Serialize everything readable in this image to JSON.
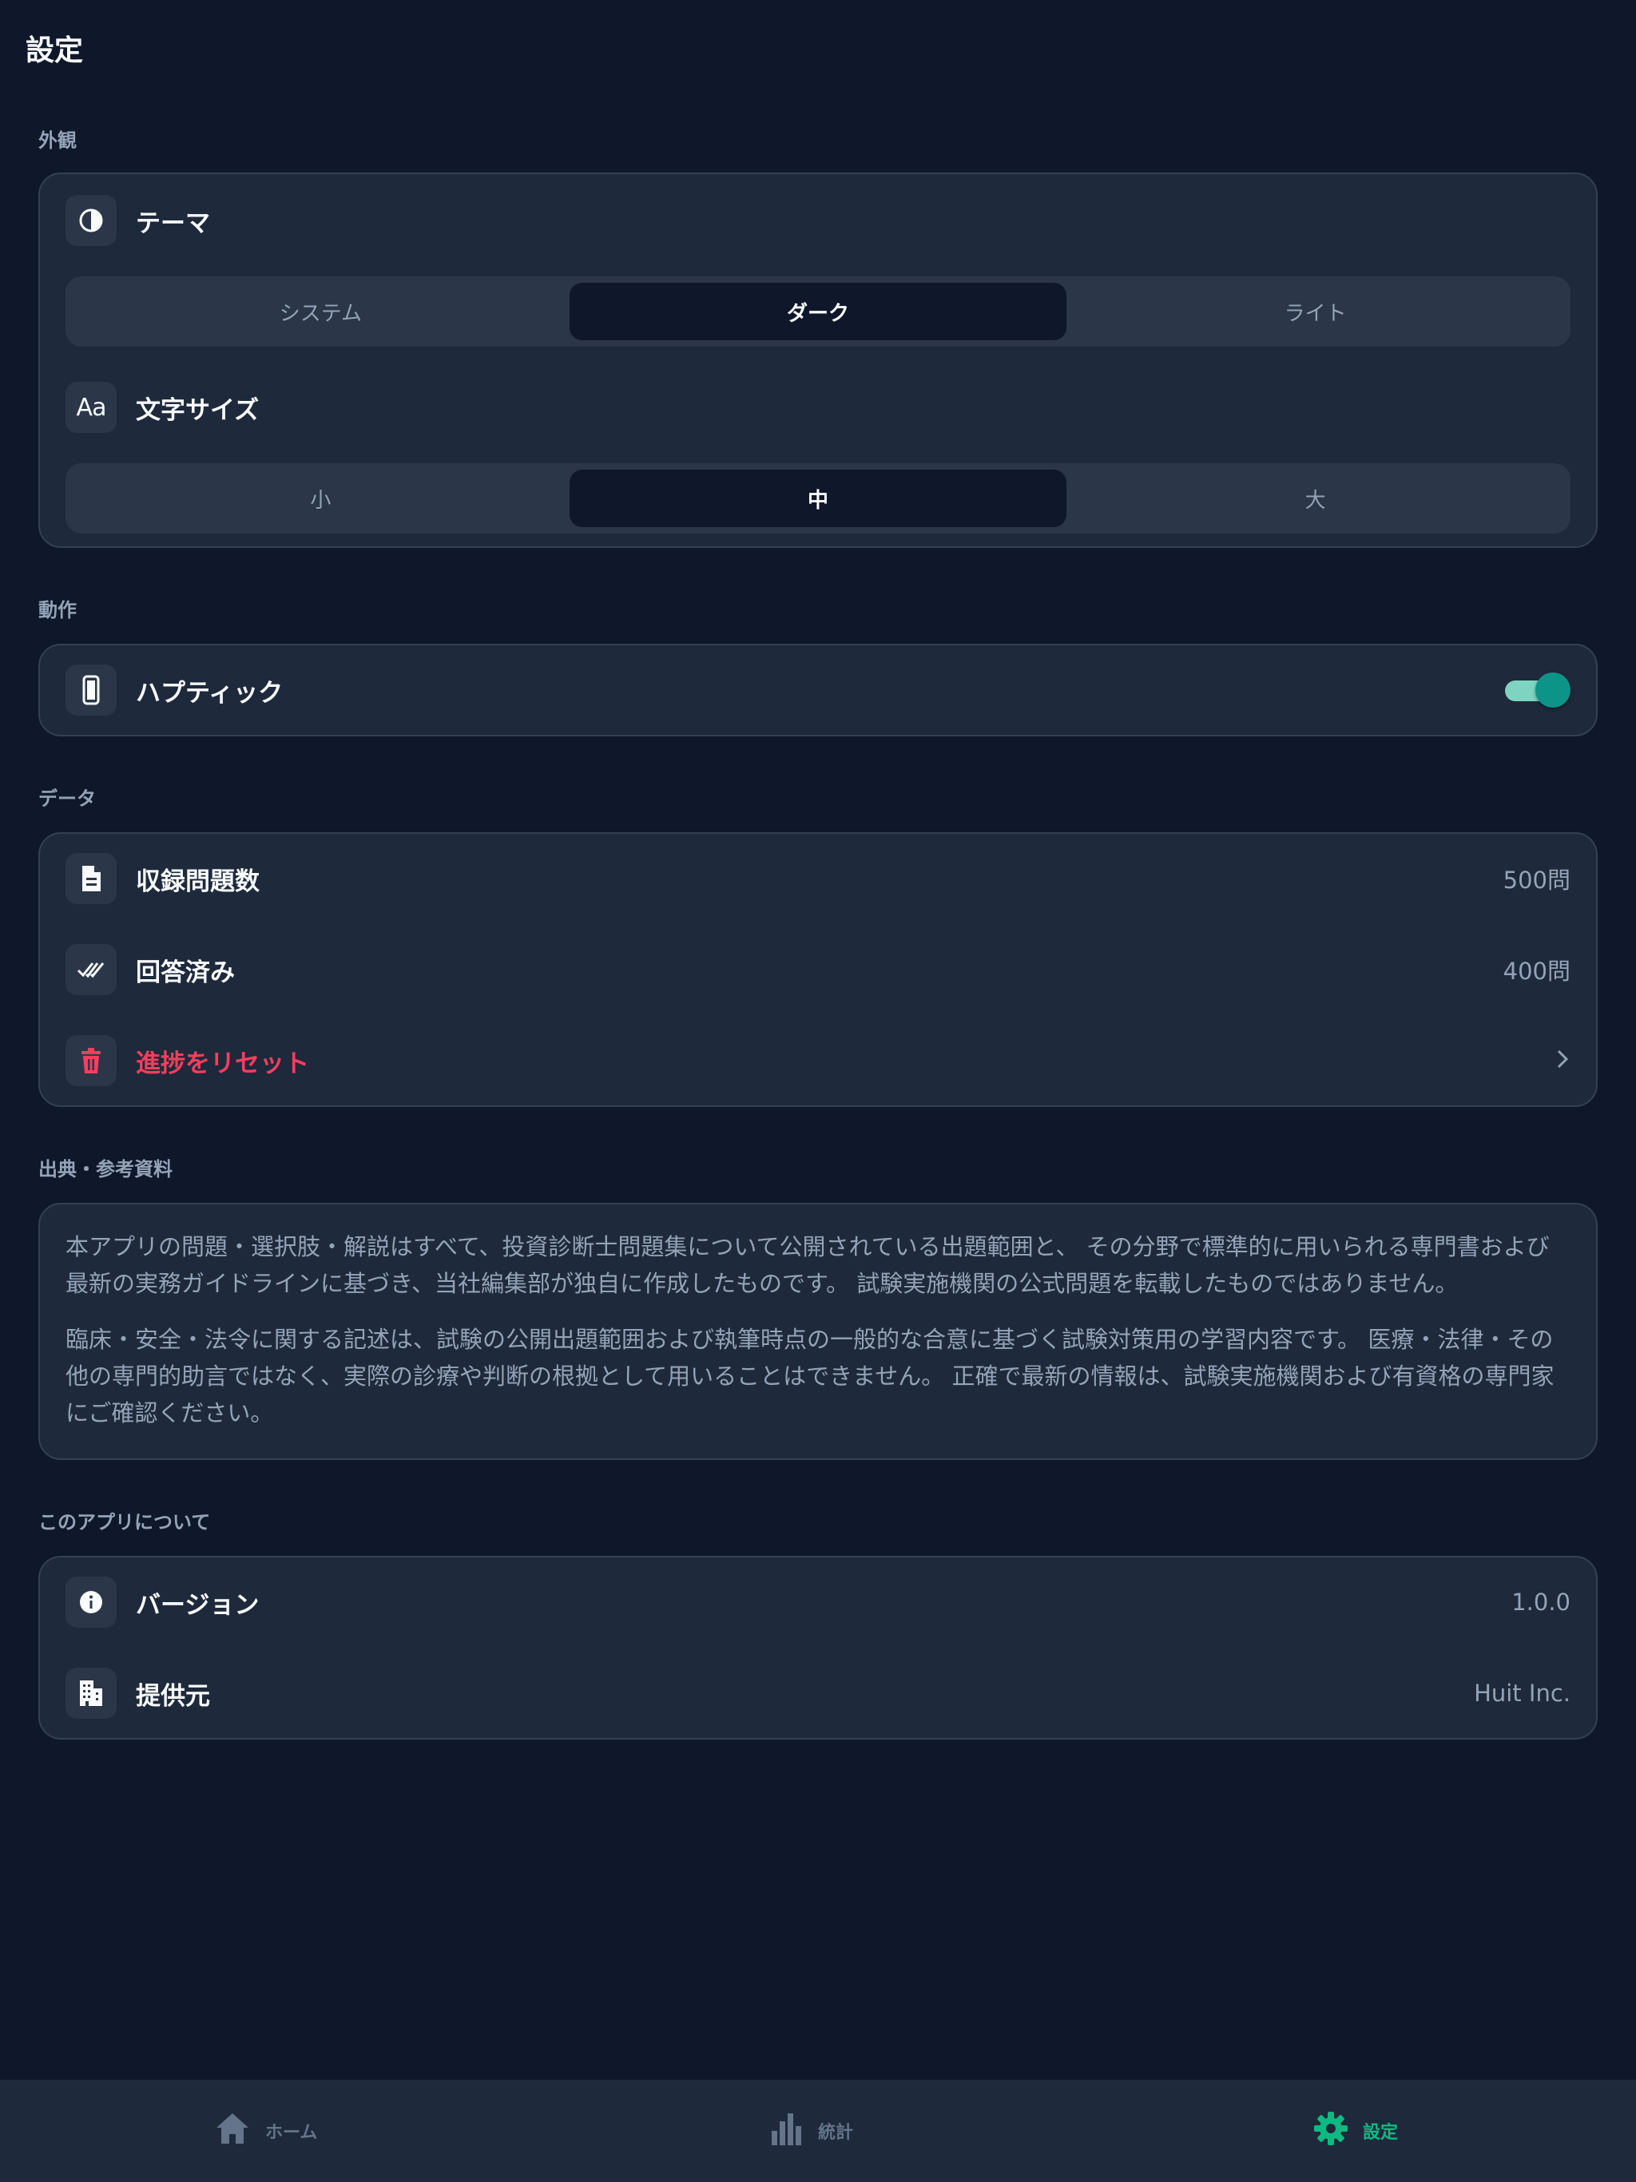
{
  "page": {
    "title": "設定"
  },
  "colors": {
    "background": "#0f172a",
    "card": "#1e293b",
    "accent": "#10b981",
    "toggle": "#0d9488",
    "danger": "#f43f5e",
    "muted": "#94a3b8"
  },
  "appearance": {
    "section_label": "外観",
    "theme": {
      "label": "テーマ",
      "icon": "contrast-icon",
      "options": [
        "システム",
        "ダーク",
        "ライト"
      ],
      "selected": "ダーク"
    },
    "font_size": {
      "label": "文字サイズ",
      "icon": "text-size-icon",
      "icon_text": "Aa",
      "options": [
        "小",
        "中",
        "大"
      ],
      "selected": "中"
    }
  },
  "behavior": {
    "section_label": "動作",
    "haptic": {
      "label": "ハプティック",
      "icon": "phone-icon",
      "enabled": true
    }
  },
  "data_section": {
    "section_label": "データ",
    "total": {
      "label": "収録問題数",
      "value": "500問",
      "icon": "document-icon"
    },
    "answered": {
      "label": "回答済み",
      "value": "400問",
      "icon": "double-check-icon"
    },
    "reset": {
      "label": "進捗をリセット",
      "icon": "trash-icon"
    }
  },
  "sources": {
    "section_label": "出典・参考資料",
    "paragraphs": [
      "本アプリの問題・選択肢・解説はすべて、投資診断士問題集について公開されている出題範囲と、 その分野で標準的に用いられる専門書および最新の実務ガイドラインに基づき、当社編集部が独自に作成したものです。 試験実施機関の公式問題を転載したものではありません。",
      "臨床・安全・法令に関する記述は、試験の公開出題範囲および執筆時点の一般的な合意に基づく試験対策用の学習内容です。 医療・法律・その他の専門的助言ではなく、実際の診療や判断の根拠として用いることはできません。 正確で最新の情報は、試験実施機関および有資格の専門家にご確認ください。"
    ]
  },
  "about": {
    "section_label": "このアプリについて",
    "version": {
      "label": "バージョン",
      "value": "1.0.0",
      "icon": "info-icon"
    },
    "provider": {
      "label": "提供元",
      "value": "Huit Inc.",
      "icon": "building-icon"
    }
  },
  "bottom_nav": {
    "items": [
      {
        "label": "ホーム",
        "icon": "home-icon",
        "active": false
      },
      {
        "label": "統計",
        "icon": "bar-chart-icon",
        "active": false
      },
      {
        "label": "設定",
        "icon": "gear-icon",
        "active": true
      }
    ]
  }
}
